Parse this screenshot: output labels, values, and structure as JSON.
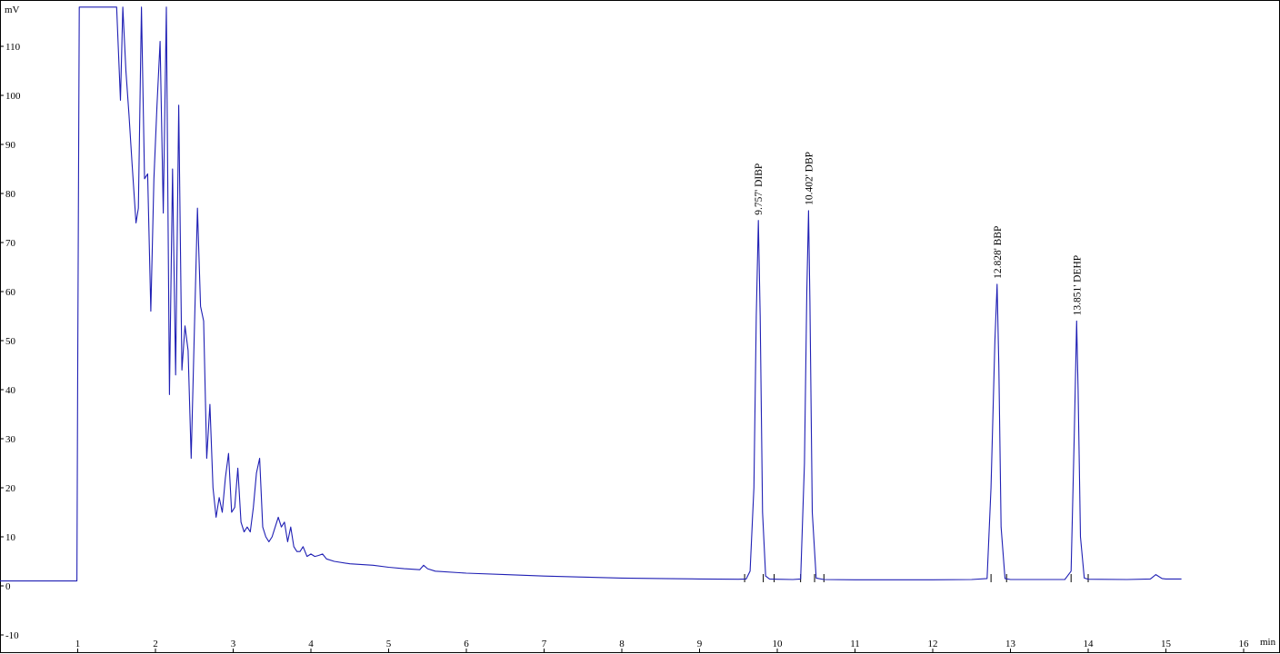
{
  "chart_data": {
    "type": "line",
    "title": "",
    "xlabel": "min",
    "ylabel": "mV",
    "xlim": [
      0,
      16
    ],
    "ylim": [
      -10,
      118
    ],
    "grid": false,
    "x_ticks": [
      1,
      2,
      3,
      4,
      5,
      6,
      7,
      8,
      9,
      10,
      11,
      12,
      13,
      14,
      15,
      16
    ],
    "x_tick_labels": [
      "1",
      "2",
      "3",
      "4",
      "5",
      "6",
      "7",
      "8",
      "9",
      "10",
      "11",
      "12",
      "13",
      "14",
      "15",
      "16"
    ],
    "y_ticks": [
      -10,
      0,
      10,
      20,
      30,
      40,
      50,
      60,
      70,
      80,
      90,
      100,
      110
    ],
    "y_tick_labels": [
      "-10",
      "0",
      "10",
      "20",
      "30",
      "40",
      "50",
      "60",
      "70",
      "80",
      "90",
      "100",
      "110"
    ],
    "series": [
      {
        "color": "#1f1fb4",
        "x": [
          0,
          0.99,
          1.0,
          1.02,
          1.04,
          1.5,
          1.55,
          1.58,
          1.62,
          1.66,
          1.7,
          1.75,
          1.78,
          1.82,
          1.86,
          1.9,
          1.94,
          1.98,
          2.02,
          2.06,
          2.1,
          2.14,
          2.18,
          2.22,
          2.26,
          2.3,
          2.34,
          2.38,
          2.42,
          2.46,
          2.5,
          2.54,
          2.58,
          2.62,
          2.66,
          2.7,
          2.74,
          2.78,
          2.82,
          2.86,
          2.9,
          2.94,
          2.98,
          3.02,
          3.06,
          3.1,
          3.14,
          3.18,
          3.22,
          3.26,
          3.3,
          3.34,
          3.38,
          3.42,
          3.46,
          3.5,
          3.54,
          3.58,
          3.62,
          3.66,
          3.7,
          3.74,
          3.78,
          3.82,
          3.86,
          3.9,
          3.95,
          4.0,
          4.05,
          4.1,
          4.15,
          4.2,
          4.3,
          4.5,
          4.8,
          5.0,
          5.2,
          5.4,
          5.45,
          5.5,
          5.6,
          6.0,
          6.5,
          7.0,
          7.5,
          8.0,
          8.5,
          9.0,
          9.5,
          9.6,
          9.65,
          9.7,
          9.73,
          9.757,
          9.78,
          9.81,
          9.85,
          9.9,
          10.0,
          10.2,
          10.3,
          10.35,
          10.38,
          10.402,
          10.42,
          10.45,
          10.5,
          10.6,
          11.0,
          11.5,
          12.0,
          12.5,
          12.7,
          12.75,
          12.8,
          12.828,
          12.85,
          12.88,
          12.93,
          13.0,
          13.5,
          13.7,
          13.78,
          13.82,
          13.851,
          13.87,
          13.9,
          13.95,
          14.0,
          14.5,
          14.8,
          14.87,
          14.95,
          15.0,
          15.2
        ],
        "y": [
          1,
          1,
          45,
          118,
          118,
          118,
          99,
          118,
          105,
          96,
          86,
          74,
          77,
          118,
          83,
          84,
          56,
          83,
          98,
          111,
          76,
          118,
          39,
          85,
          43,
          98,
          44,
          53,
          48,
          26,
          52,
          77,
          57,
          54,
          26,
          37,
          20,
          14,
          18,
          15,
          22,
          27,
          15,
          16,
          24,
          13,
          11,
          12,
          11,
          16,
          23,
          26,
          12,
          10,
          9,
          10,
          12,
          14,
          12,
          13,
          9,
          12,
          8,
          7,
          7,
          8,
          6,
          6.5,
          6,
          6.2,
          6.5,
          5.5,
          5,
          4.5,
          4.2,
          3.8,
          3.5,
          3.3,
          4.2,
          3.5,
          3,
          2.6,
          2.3,
          2,
          1.8,
          1.6,
          1.5,
          1.4,
          1.35,
          1.4,
          3,
          20,
          55,
          74.5,
          55,
          15,
          2,
          1.4,
          1.35,
          1.3,
          1.4,
          25,
          60,
          76.5,
          58,
          15,
          1.6,
          1.3,
          1.25,
          1.25,
          1.25,
          1.3,
          1.5,
          20,
          50,
          61.5,
          45,
          12,
          1.5,
          1.3,
          1.3,
          1.3,
          3,
          30,
          54,
          40,
          10,
          1.6,
          1.35,
          1.3,
          1.4,
          2.3,
          1.5,
          1.4,
          1.4
        ]
      }
    ],
    "peaks": [
      {
        "rt": 9.757,
        "height": 74.5,
        "label": "9.757'  DIBP"
      },
      {
        "rt": 10.402,
        "height": 76.5,
        "label": "10.402'  DBP"
      },
      {
        "rt": 12.828,
        "height": 61.5,
        "label": "12.828'  BBP"
      },
      {
        "rt": 13.851,
        "height": 54,
        "label": "13.851'  DEHP"
      }
    ],
    "integration_marks": [
      9.58,
      9.82,
      9.96,
      10.3,
      10.48,
      10.6,
      12.75,
      12.95,
      13.78,
      14.0
    ]
  }
}
